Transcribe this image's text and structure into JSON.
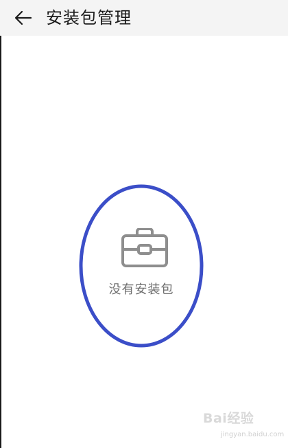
{
  "header": {
    "title": "安装包管理",
    "back_icon": "arrow-left-icon"
  },
  "empty_state": {
    "icon": "briefcase-icon",
    "message": "没有安装包"
  },
  "annotation": {
    "ring_color": "#3b4ec8"
  },
  "watermark": {
    "logo": "Bai经验",
    "url": "jingyan.baidu.com"
  }
}
